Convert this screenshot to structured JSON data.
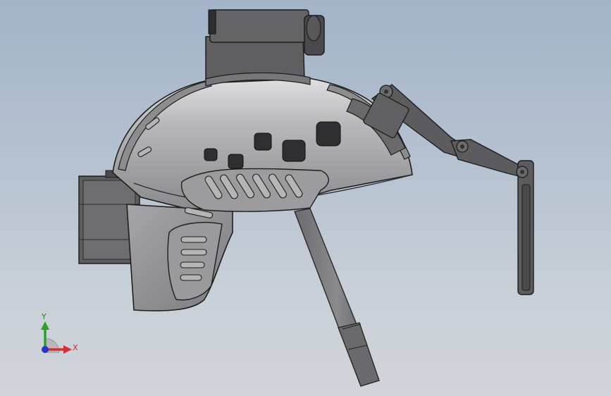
{
  "viewport": {
    "background_top": "#a3b4c9",
    "background_bottom": "#d1d4d9"
  },
  "model": {
    "shell_color": "#8e8e91",
    "shell_highlight": "#d6d6d8",
    "dark_part_color": "#3c3c3e",
    "mount_color": "#5d5d60",
    "edge_color": "#1e1e1e"
  },
  "triad": {
    "x_label": "X",
    "y_label": "Y",
    "x_color": "#d32f2f",
    "y_color": "#2e9d2e",
    "z_color": "#2435c8"
  }
}
